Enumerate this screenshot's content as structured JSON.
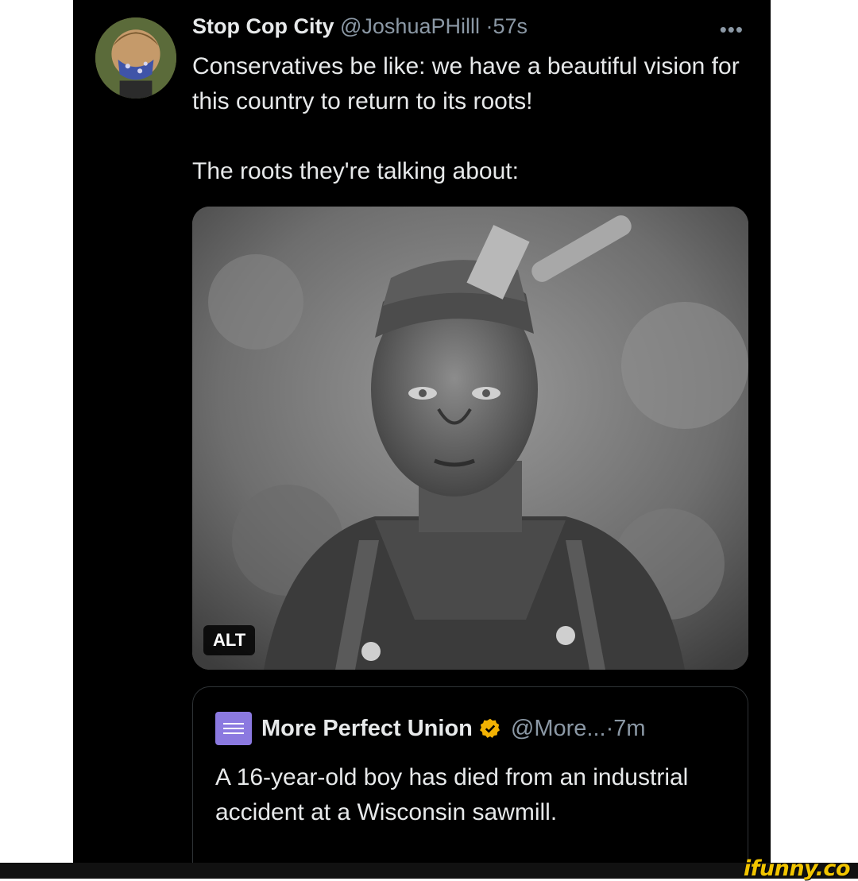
{
  "tweet": {
    "display_name": "Stop Cop City",
    "handle": "@JoshuaPHilll",
    "separator": "·",
    "time": "57s",
    "more_icon": "more-horizontal-icon",
    "line1": "Conservatives be like: we have a beautiful vision for this country to return to its roots!",
    "line2": "The roots they're talking about:",
    "media_alt_label": "ALT"
  },
  "quote": {
    "display_name": "More Perfect Union",
    "verified_icon": "verified-badge-icon",
    "handle": "@More...",
    "separator": "·",
    "time": "7m",
    "text": "A 16-year-old boy has died from an industrial accident at a Wisconsin sawmill."
  },
  "watermark": {
    "text": "ifunny.co"
  },
  "colors": {
    "background": "#000000",
    "text": "#e7e9ea",
    "muted": "#8b98a5",
    "verified": "#f2b203",
    "watermark": "#f2c500"
  }
}
